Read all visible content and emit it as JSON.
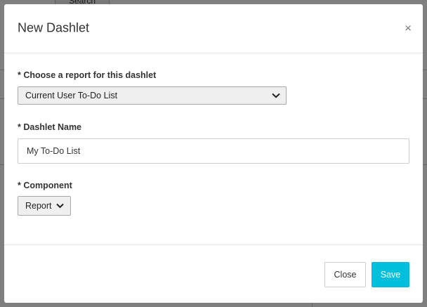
{
  "background": {
    "search_button": "Search"
  },
  "modal": {
    "title": "New Dashlet",
    "close_glyph": "×",
    "report_field": {
      "label": "* Choose a report for this dashlet",
      "selected": "Current User To-Do List"
    },
    "name_field": {
      "label": "* Dashlet Name",
      "value": "My To-Do List"
    },
    "component_field": {
      "label": "* Component",
      "selected": "Report"
    },
    "footer": {
      "close_label": "Close",
      "save_label": "Save"
    }
  },
  "colors": {
    "save_button": "#00bfdd",
    "overlay": "rgba(0,0,0,0.5)"
  },
  "icons": [
    "close-icon",
    "chevron-down-icon"
  ]
}
